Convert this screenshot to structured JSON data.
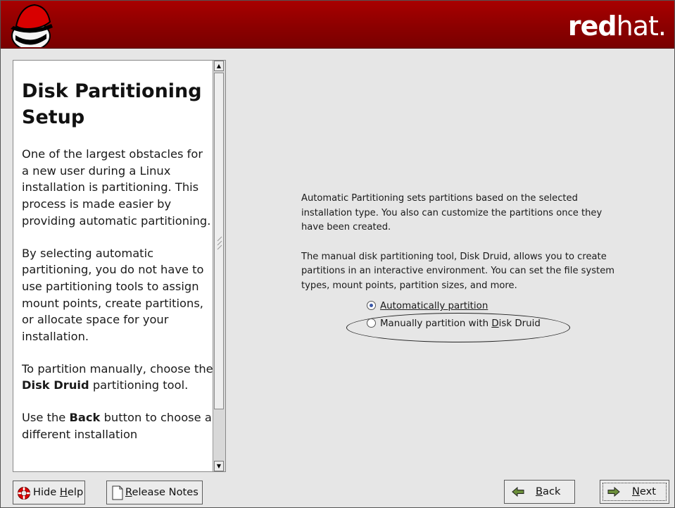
{
  "banner": {
    "brand_bold": "red",
    "brand_light": "hat.",
    "logo_icon": "redhat-shadowman-logo"
  },
  "help": {
    "title": "Disk Partitioning Setup",
    "paragraphs": [
      "One of the largest obstacles for a new user during a Linux installation is partitioning. This process is made easier by providing automatic partitioning.",
      "By selecting automatic partitioning, you do not have to use partitioning tools to assign mount points, create partitions, or allocate space for your installation."
    ],
    "p3_pre": "To partition manually, choose the ",
    "p3_bold": "Disk Druid",
    "p3_post": " partitioning tool.",
    "p4_pre": "Use the ",
    "p4_bold": "Back",
    "p4_post": " button to choose a different installation"
  },
  "main": {
    "paragraph1": "Automatic Partitioning sets partitions based on the selected installation type. You also can customize the partitions once they have been created.",
    "paragraph2": "The manual disk partitioning tool, Disk Druid, allows you to create partitions in an interactive environment. You can set the file system types, mount points, partition sizes, and more.",
    "options": {
      "auto_label": "Automatically partition",
      "manual_pre": "Manually partition with ",
      "manual_ul": "D",
      "manual_post": "isk Druid",
      "selected": "auto"
    }
  },
  "buttons": {
    "hide_help_pre": "Hide ",
    "hide_help_ul": "H",
    "hide_help_post": "elp",
    "release_notes_ul": "R",
    "release_notes_post": "elease Notes",
    "back_ul": "B",
    "back_post": "ack",
    "next_ul": "N",
    "next_post": "ext"
  },
  "colors": {
    "banner_red": "#8c0000",
    "radio_selected": "#3a58a8"
  }
}
